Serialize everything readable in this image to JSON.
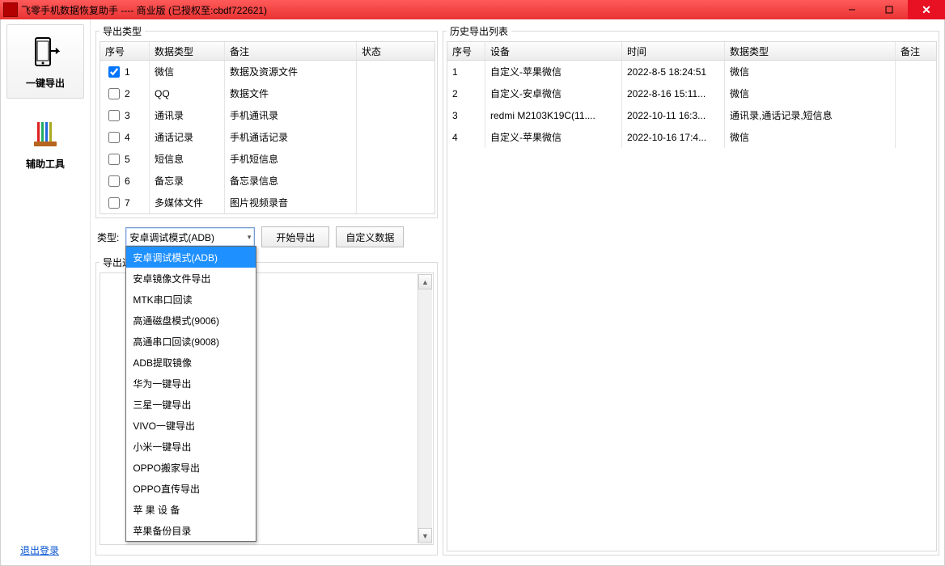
{
  "window": {
    "title": "飞零手机数据恢复助手    ----    商业版 (已授权至:cbdf722621)"
  },
  "sidebar": {
    "items": [
      {
        "label": "一键导出"
      },
      {
        "label": "辅助工具"
      }
    ],
    "logout": "退出登录"
  },
  "export_types": {
    "legend": "导出类型",
    "headers": {
      "idx": "序号",
      "type": "数据类型",
      "note": "备注",
      "status": "状态"
    },
    "rows": [
      {
        "checked": true,
        "idx": "1",
        "type": "微信",
        "note": "数据及资源文件"
      },
      {
        "checked": false,
        "idx": "2",
        "type": "QQ",
        "note": "数据文件"
      },
      {
        "checked": false,
        "idx": "3",
        "type": "通讯录",
        "note": "手机通讯录"
      },
      {
        "checked": false,
        "idx": "4",
        "type": "通话记录",
        "note": "手机通话记录"
      },
      {
        "checked": false,
        "idx": "5",
        "type": "短信息",
        "note": "手机短信息"
      },
      {
        "checked": false,
        "idx": "6",
        "type": "备忘录",
        "note": "备忘录信息"
      },
      {
        "checked": false,
        "idx": "7",
        "type": "多媒体文件",
        "note": "图片视频录音"
      }
    ]
  },
  "type_selector": {
    "label": "类型:",
    "selected": "安卓调试模式(ADB)",
    "options": [
      "安卓调试模式(ADB)",
      "安卓镜像文件导出",
      "MTK串口回读",
      "高通磁盘模式(9006)",
      "高通串口回读(9008)",
      "ADB提取镜像",
      "华为一键导出",
      "三星一键导出",
      "VIVO一键导出",
      "小米一键导出",
      "OPPO搬家导出",
      "OPPO直传导出",
      "苹 果 设 备",
      "苹果备份目录"
    ]
  },
  "buttons": {
    "start": "开始导出",
    "custom": "自定义数据"
  },
  "process": {
    "legend": "导出过程"
  },
  "history": {
    "legend": "历史导出列表",
    "headers": {
      "idx": "序号",
      "device": "设备",
      "time": "时间",
      "type": "数据类型",
      "note": "备注"
    },
    "rows": [
      {
        "idx": "1",
        "device": "自定义-苹果微信",
        "time": "2022-8-5 18:24:51",
        "type": "微信"
      },
      {
        "idx": "2",
        "device": "自定义-安卓微信",
        "time": "2022-8-16 15:11...",
        "type": "微信"
      },
      {
        "idx": "3",
        "device": "redmi M2103K19C(11....",
        "time": "2022-10-11 16:3...",
        "type": "通讯录,通话记录,短信息"
      },
      {
        "idx": "4",
        "device": "自定义-苹果微信",
        "time": "2022-10-16 17:4...",
        "type": "微信"
      }
    ]
  }
}
